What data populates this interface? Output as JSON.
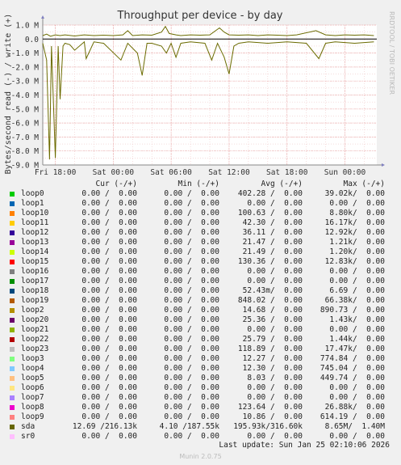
{
  "chart_data": {
    "type": "line",
    "title": "Throughput per device - by day",
    "ylabel": "Bytes/second read (-) / write (+)",
    "side_label": "RRDTOOL / TOBI OETIKER",
    "ylim": [
      -9000000,
      1000000
    ],
    "yticks": [
      "1.0 M",
      "0.0",
      "-1.0 M",
      "-2.0 M",
      "-3.0 M",
      "-4.0 M",
      "-5.0 M",
      "-6.0 M",
      "-7.0 M",
      "-8.0 M",
      "-9.0 M"
    ],
    "xticks": [
      "Fri 18:00",
      "Sat 00:00",
      "Sat 06:00",
      "Sat 12:00",
      "Sat 18:00",
      "Sun 00:00"
    ],
    "x_hours": [
      0,
      6,
      12,
      18,
      24,
      30
    ],
    "xlim_hours": [
      -1.3,
      33.3
    ],
    "grid": true,
    "series": [
      {
        "name": "sda",
        "color": "#6b6b00",
        "write": [
          [
            -1.3,
            0.25
          ],
          [
            -0.9,
            0.35
          ],
          [
            -0.5,
            0.2
          ],
          [
            0,
            0.3
          ],
          [
            0.5,
            0.25
          ],
          [
            1,
            0.3
          ],
          [
            2,
            0.22
          ],
          [
            3,
            0.3
          ],
          [
            4,
            0.25
          ],
          [
            5,
            0.28
          ],
          [
            6,
            0.25
          ],
          [
            7,
            0.3
          ],
          [
            7.5,
            0.6
          ],
          [
            8,
            0.25
          ],
          [
            9,
            0.3
          ],
          [
            10,
            0.28
          ],
          [
            11,
            0.5
          ],
          [
            11.4,
            0.9
          ],
          [
            11.8,
            0.4
          ],
          [
            12.5,
            0.3
          ],
          [
            13,
            0.25
          ],
          [
            14,
            0.3
          ],
          [
            15,
            0.28
          ],
          [
            16,
            0.3
          ],
          [
            17,
            0.8
          ],
          [
            17.5,
            0.5
          ],
          [
            18,
            0.3
          ],
          [
            19,
            0.28
          ],
          [
            20,
            0.3
          ],
          [
            21,
            0.25
          ],
          [
            22,
            0.3
          ],
          [
            23,
            0.28
          ],
          [
            24,
            0.25
          ],
          [
            25,
            0.3
          ],
          [
            27,
            0.6
          ],
          [
            28,
            0.3
          ],
          [
            29,
            0.25
          ],
          [
            30,
            0.3
          ],
          [
            31,
            0.28
          ],
          [
            32,
            0.3
          ],
          [
            33,
            0.25
          ]
        ],
        "read": [
          [
            -1.3,
            -0.3
          ],
          [
            -0.9,
            -1.5
          ],
          [
            -0.6,
            -8.6
          ],
          [
            -0.4,
            -0.5
          ],
          [
            0,
            -8.5
          ],
          [
            0.3,
            -0.5
          ],
          [
            0.5,
            -4.3
          ],
          [
            0.8,
            -0.5
          ],
          [
            1,
            -0.3
          ],
          [
            1.5,
            -0.4
          ],
          [
            2,
            -0.8
          ],
          [
            3,
            -0.2
          ],
          [
            3.2,
            -1.4
          ],
          [
            4,
            -0.2
          ],
          [
            5,
            -0.3
          ],
          [
            6.8,
            -1.5
          ],
          [
            7.5,
            -0.3
          ],
          [
            8.5,
            -1
          ],
          [
            9,
            -2.6
          ],
          [
            9.5,
            -0.3
          ],
          [
            10,
            -0.3
          ],
          [
            11,
            -0.5
          ],
          [
            11.5,
            -1
          ],
          [
            12,
            -0.3
          ],
          [
            12.5,
            -1.3
          ],
          [
            13,
            -0.3
          ],
          [
            14,
            -0.2
          ],
          [
            15.5,
            -0.3
          ],
          [
            16.2,
            -1.5
          ],
          [
            16.8,
            -0.3
          ],
          [
            17.5,
            -1.3
          ],
          [
            18,
            -2.5
          ],
          [
            18.5,
            -0.5
          ],
          [
            19,
            -0.3
          ],
          [
            20,
            -0.2
          ],
          [
            22,
            -0.3
          ],
          [
            24,
            -0.2
          ],
          [
            26,
            -0.3
          ],
          [
            27.3,
            -1.4
          ],
          [
            28,
            -0.3
          ],
          [
            29,
            -0.2
          ],
          [
            31,
            -0.3
          ],
          [
            33,
            -0.2
          ]
        ]
      }
    ]
  },
  "legend": {
    "header": {
      "cur": "Cur (-/+)",
      "min": "Min (-/+)",
      "avg": "Avg (-/+)",
      "max": "Max (-/+)"
    },
    "rows": [
      {
        "name": "loop0",
        "color": "#00cc00",
        "cur": "0.00 /  0.00",
        "min": "0.00 /  0.00",
        "avg": "402.28 /  0.00",
        "max": "39.02k/  0.00"
      },
      {
        "name": "loop1",
        "color": "#0066b3",
        "cur": "0.00 /  0.00",
        "min": "0.00 /  0.00",
        "avg": "0.00 /  0.00",
        "max": "0.00 /  0.00"
      },
      {
        "name": "loop10",
        "color": "#ff8000",
        "cur": "0.00 /  0.00",
        "min": "0.00 /  0.00",
        "avg": "100.63 /  0.00",
        "max": "8.80k/  0.00"
      },
      {
        "name": "loop11",
        "color": "#ffcc00",
        "cur": "0.00 /  0.00",
        "min": "0.00 /  0.00",
        "avg": "42.30 /  0.00",
        "max": "16.17k/  0.00"
      },
      {
        "name": "loop12",
        "color": "#330099",
        "cur": "0.00 /  0.00",
        "min": "0.00 /  0.00",
        "avg": "36.11 /  0.00",
        "max": "12.92k/  0.00"
      },
      {
        "name": "loop13",
        "color": "#990099",
        "cur": "0.00 /  0.00",
        "min": "0.00 /  0.00",
        "avg": "21.47 /  0.00",
        "max": "1.21k/  0.00"
      },
      {
        "name": "loop14",
        "color": "#ccff00",
        "cur": "0.00 /  0.00",
        "min": "0.00 /  0.00",
        "avg": "21.49 /  0.00",
        "max": "1.20k/  0.00"
      },
      {
        "name": "loop15",
        "color": "#ff0000",
        "cur": "0.00 /  0.00",
        "min": "0.00 /  0.00",
        "avg": "130.36 /  0.00",
        "max": "12.83k/  0.00"
      },
      {
        "name": "loop16",
        "color": "#808080",
        "cur": "0.00 /  0.00",
        "min": "0.00 /  0.00",
        "avg": "0.00 /  0.00",
        "max": "0.00 /  0.00"
      },
      {
        "name": "loop17",
        "color": "#008f00",
        "cur": "0.00 /  0.00",
        "min": "0.00 /  0.00",
        "avg": "0.00 /  0.00",
        "max": "0.00 /  0.00"
      },
      {
        "name": "loop18",
        "color": "#00487d",
        "cur": "0.00 /  0.00",
        "min": "0.00 /  0.00",
        "avg": "52.43m/  0.00",
        "max": "6.69 /  0.00"
      },
      {
        "name": "loop19",
        "color": "#b35a00",
        "cur": "0.00 /  0.00",
        "min": "0.00 /  0.00",
        "avg": "848.02 /  0.00",
        "max": "66.38k/  0.00"
      },
      {
        "name": "loop2",
        "color": "#b38f00",
        "cur": "0.00 /  0.00",
        "min": "0.00 /  0.00",
        "avg": "14.68 /  0.00",
        "max": "890.73 /  0.00"
      },
      {
        "name": "loop20",
        "color": "#6b006b",
        "cur": "0.00 /  0.00",
        "min": "0.00 /  0.00",
        "avg": "25.36 /  0.00",
        "max": "1.43k/  0.00"
      },
      {
        "name": "loop21",
        "color": "#8fb300",
        "cur": "0.00 /  0.00",
        "min": "0.00 /  0.00",
        "avg": "0.00 /  0.00",
        "max": "0.00 /  0.00"
      },
      {
        "name": "loop22",
        "color": "#b30000",
        "cur": "0.00 /  0.00",
        "min": "0.00 /  0.00",
        "avg": "25.79 /  0.00",
        "max": "1.44k/  0.00"
      },
      {
        "name": "loop23",
        "color": "#bebebe",
        "cur": "0.00 /  0.00",
        "min": "0.00 /  0.00",
        "avg": "118.89 /  0.00",
        "max": "17.47k/  0.00"
      },
      {
        "name": "loop3",
        "color": "#80ff80",
        "cur": "0.00 /  0.00",
        "min": "0.00 /  0.00",
        "avg": "12.27 /  0.00",
        "max": "774.84 /  0.00"
      },
      {
        "name": "loop4",
        "color": "#80c9ff",
        "cur": "0.00 /  0.00",
        "min": "0.00 /  0.00",
        "avg": "12.30 /  0.00",
        "max": "745.04 /  0.00"
      },
      {
        "name": "loop5",
        "color": "#ffc080",
        "cur": "0.00 /  0.00",
        "min": "0.00 /  0.00",
        "avg": "8.03 /  0.00",
        "max": "449.74 /  0.00"
      },
      {
        "name": "loop6",
        "color": "#ffe680",
        "cur": "0.00 /  0.00",
        "min": "0.00 /  0.00",
        "avg": "0.00 /  0.00",
        "max": "0.00 /  0.00"
      },
      {
        "name": "loop7",
        "color": "#aa80ff",
        "cur": "0.00 /  0.00",
        "min": "0.00 /  0.00",
        "avg": "0.00 /  0.00",
        "max": "0.00 /  0.00"
      },
      {
        "name": "loop8",
        "color": "#ee00cc",
        "cur": "0.00 /  0.00",
        "min": "0.00 /  0.00",
        "avg": "123.64 /  0.00",
        "max": "26.88k/  0.00"
      },
      {
        "name": "loop9",
        "color": "#ff8080",
        "cur": "0.00 /  0.00",
        "min": "0.00 /  0.00",
        "avg": "10.86 /  0.00",
        "max": "614.19 /  0.00"
      },
      {
        "name": "sda",
        "color": "#666600",
        "cur": "12.69 /216.13k",
        "min": "4.10 /187.55k",
        "avg": "195.93k/316.60k",
        "max": "8.65M/  1.40M"
      },
      {
        "name": "sr0",
        "color": "#ffbfff",
        "cur": "0.00 /  0.00",
        "min": "0.00 /  0.00",
        "avg": "0.00 /  0.00",
        "max": "0.00 /  0.00"
      }
    ]
  },
  "footer": "Last update: Sun Jan 25 02:10:06 2026",
  "version": "Munin 2.0.75"
}
